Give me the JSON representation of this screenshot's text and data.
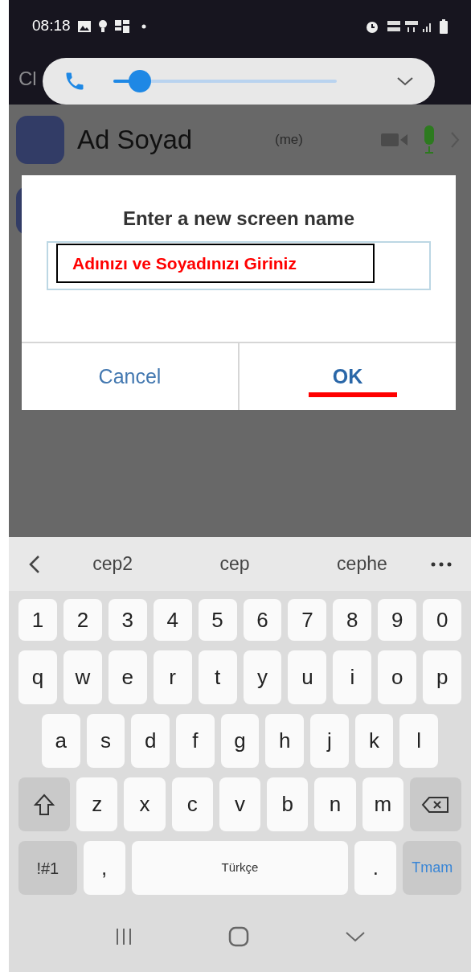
{
  "status_bar": {
    "time": "08:18"
  },
  "header": {
    "title": "Cl"
  },
  "volume_popup": {
    "level": 0.12
  },
  "participants": [
    {
      "name": "Ad Soyad",
      "tag": "(me)"
    }
  ],
  "dialog": {
    "title": "Enter a new screen name",
    "annotation": "Adınızı ve Soyadınızı Giriniz",
    "buttons": [
      {
        "label": "Cancel",
        "primary": false,
        "underlined": false
      },
      {
        "label": "OK",
        "primary": true,
        "underlined": true
      }
    ]
  },
  "keyboard": {
    "suggestions": [
      "cep2",
      "cep",
      "cephe"
    ],
    "letter_rows": [
      [
        {
          "kind": "char",
          "label": "1"
        },
        {
          "kind": "char",
          "label": "2"
        },
        {
          "kind": "char",
          "label": "3"
        },
        {
          "kind": "char",
          "label": "4"
        },
        {
          "kind": "char",
          "label": "5"
        },
        {
          "kind": "char",
          "label": "6"
        },
        {
          "kind": "char",
          "label": "7"
        },
        {
          "kind": "char",
          "label": "8"
        },
        {
          "kind": "char",
          "label": "9"
        },
        {
          "kind": "char",
          "label": "0"
        }
      ],
      [
        {
          "kind": "char",
          "label": "q"
        },
        {
          "kind": "char",
          "label": "w"
        },
        {
          "kind": "char",
          "label": "e"
        },
        {
          "kind": "char",
          "label": "r"
        },
        {
          "kind": "char",
          "label": "t"
        },
        {
          "kind": "char",
          "label": "y"
        },
        {
          "kind": "char",
          "label": "u"
        },
        {
          "kind": "char",
          "label": "i"
        },
        {
          "kind": "char",
          "label": "o"
        },
        {
          "kind": "char",
          "label": "p"
        }
      ],
      [
        {
          "kind": "char",
          "label": "a"
        },
        {
          "kind": "char",
          "label": "s"
        },
        {
          "kind": "char",
          "label": "d"
        },
        {
          "kind": "char",
          "label": "f"
        },
        {
          "kind": "char",
          "label": "g"
        },
        {
          "kind": "char",
          "label": "h"
        },
        {
          "kind": "char",
          "label": "j"
        },
        {
          "kind": "char",
          "label": "k"
        },
        {
          "kind": "char",
          "label": "l"
        }
      ],
      [
        {
          "kind": "shift"
        },
        {
          "kind": "char",
          "label": "z"
        },
        {
          "kind": "char",
          "label": "x"
        },
        {
          "kind": "char",
          "label": "c"
        },
        {
          "kind": "char",
          "label": "v"
        },
        {
          "kind": "char",
          "label": "b"
        },
        {
          "kind": "char",
          "label": "n"
        },
        {
          "kind": "char",
          "label": "m"
        },
        {
          "kind": "backspace"
        }
      ]
    ],
    "bottom_row": {
      "symbols_key": "!#1",
      "comma_key": ",",
      "space_key": "Türkçe",
      "period_key": ".",
      "done_key": "Tmam"
    }
  }
}
